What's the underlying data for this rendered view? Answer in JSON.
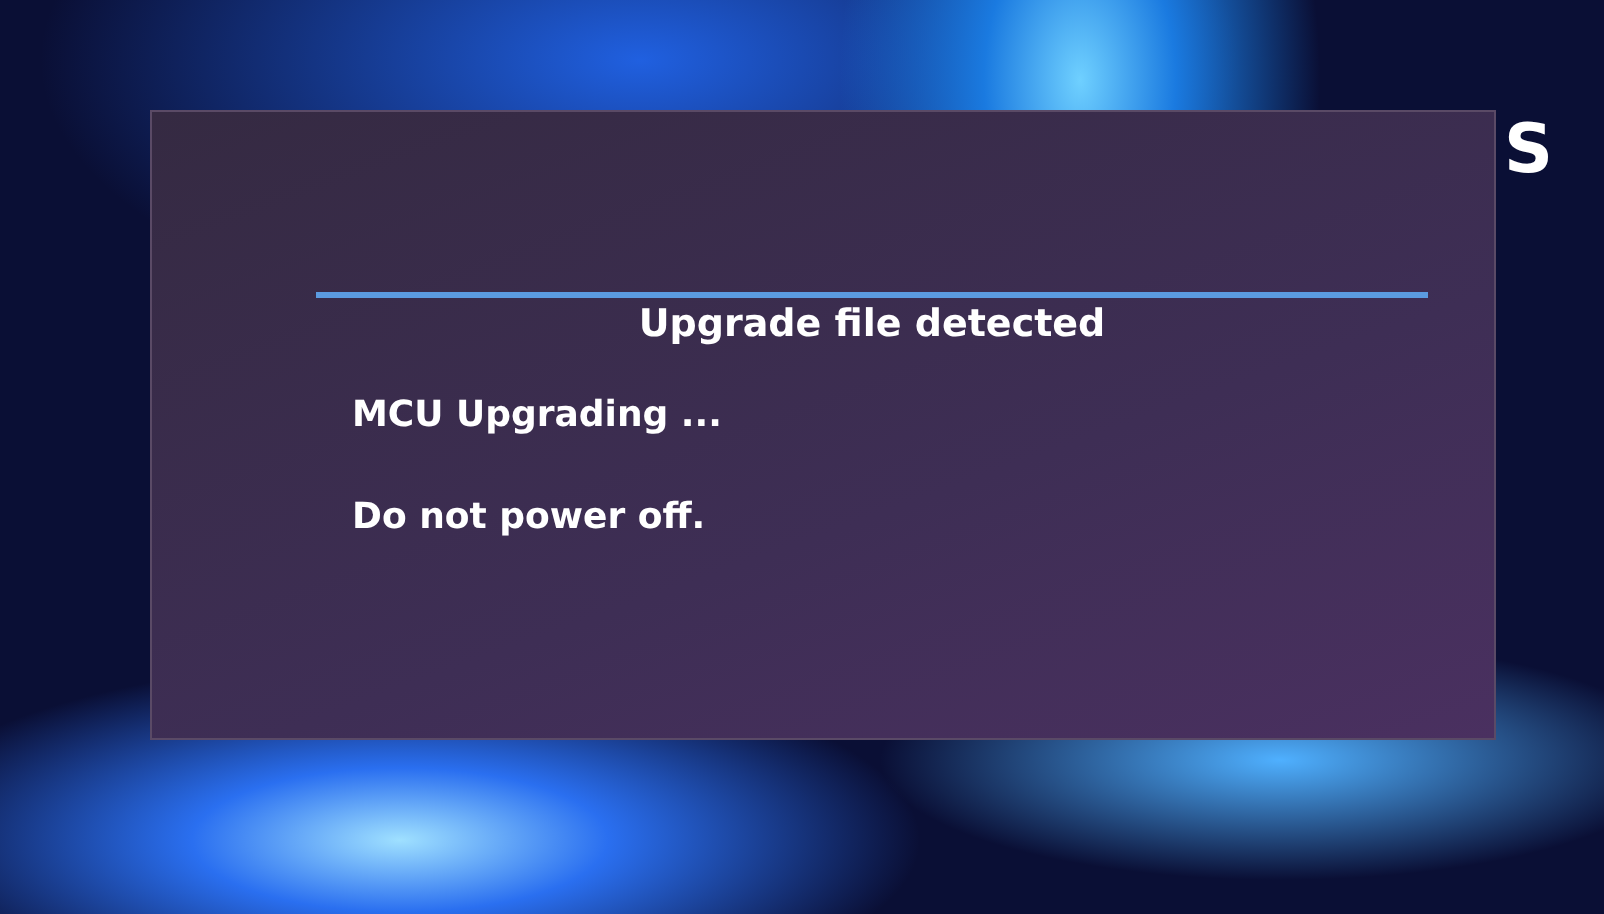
{
  "logo": {
    "text": "S"
  },
  "dialog": {
    "title": "Upgrade file detected",
    "messages": [
      "MCU Upgrading ...",
      "Do not power off."
    ]
  }
}
